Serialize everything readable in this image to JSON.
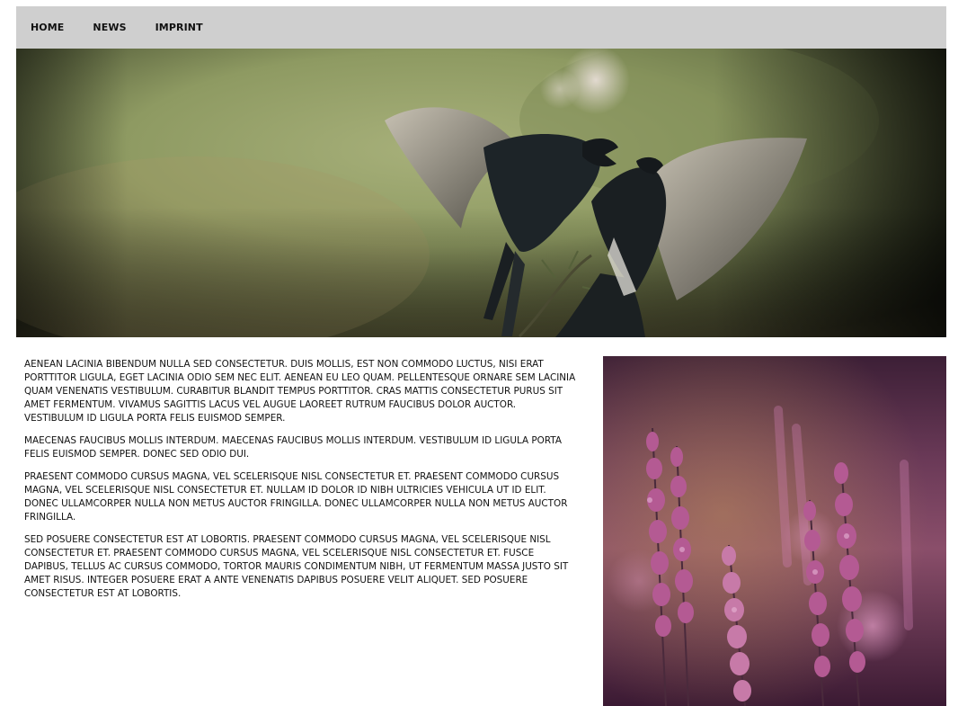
{
  "nav": {
    "items": [
      {
        "label": "HOME"
      },
      {
        "label": "NEWS"
      },
      {
        "label": "IMPRINT"
      }
    ]
  },
  "hero": {
    "image": "two-birds-fighting-photo"
  },
  "content": {
    "paragraphs": [
      "AENEAN LACINIA BIBENDUM NULLA SED CONSECTETUR. DUIS MOLLIS, EST NON COMMODO LUCTUS, NISI ERAT PORTTITOR LIGULA, EGET LACINIA ODIO SEM NEC ELIT. AENEAN EU LEO QUAM. PELLENTESQUE ORNARE SEM LACINIA QUAM VENENATIS VESTIBULUM. CURABITUR BLANDIT TEMPUS PORTTITOR. CRAS MATTIS CONSECTETUR PURUS SIT AMET FERMENTUM. VIVAMUS SAGITTIS LACUS VEL AUGUE LAOREET RUTRUM FAUCIBUS DOLOR AUCTOR. VESTIBULUM ID LIGULA PORTA FELIS EUISMOD SEMPER.",
      "MAECENAS FAUCIBUS MOLLIS INTERDUM. MAECENAS FAUCIBUS MOLLIS INTERDUM. VESTIBULUM ID LIGULA PORTA FELIS EUISMOD SEMPER. DONEC SED ODIO DUI.",
      "PRAESENT COMMODO CURSUS MAGNA, VEL SCELERISQUE NISL CONSECTETUR ET. PRAESENT COMMODO CURSUS MAGNA, VEL SCELERISQUE NISL CONSECTETUR ET. NULLAM ID DOLOR ID NIBH ULTRICIES VEHICULA UT ID ELIT. DONEC ULLAMCORPER NULLA NON METUS AUCTOR FRINGILLA. DONEC ULLAMCORPER NULLA NON METUS AUCTOR FRINGILLA.",
      "SED POSUERE CONSECTETUR EST AT LOBORTIS. PRAESENT COMMODO CURSUS MAGNA, VEL SCELERISQUE NISL CONSECTETUR ET. PRAESENT COMMODO CURSUS MAGNA, VEL SCELERISQUE NISL CONSECTETUR ET. FUSCE DAPIBUS, TELLUS AC CURSUS COMMODO, TORTOR MAURIS CONDIMENTUM NIBH, UT FERMENTUM MASSA JUSTO SIT AMET RISUS. INTEGER POSUERE ERAT A ANTE VENENATIS DAPIBUS POSUERE VELIT ALIQUET. SED POSUERE CONSECTETUR EST AT LOBORTIS."
    ]
  },
  "side": {
    "image": "purple-lavender-flowers-photo"
  },
  "colors": {
    "nav_bg": "#cfcfcf",
    "text": "#111111"
  }
}
